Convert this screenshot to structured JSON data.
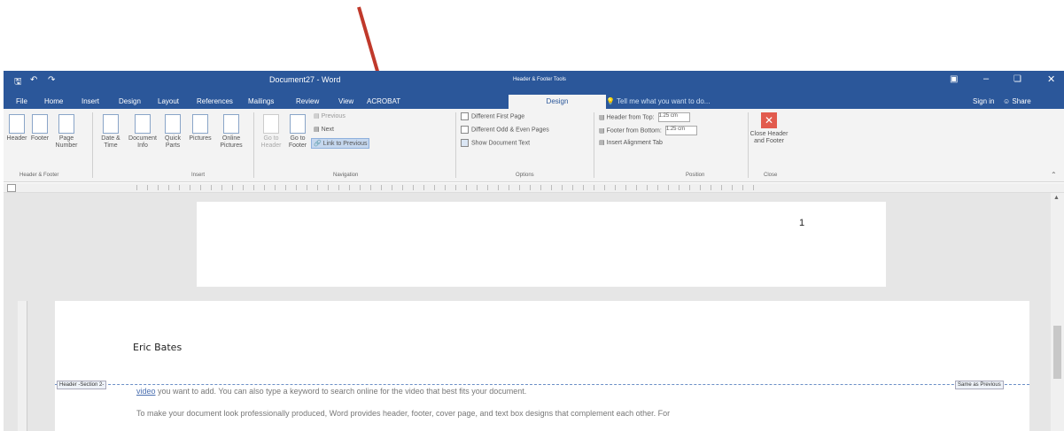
{
  "window": {
    "title": "Document27 - Word",
    "context_tab_group": "Header & Footer Tools",
    "tell_me": "Tell me what you want to do...",
    "sign_in": "Sign in",
    "share": "Share"
  },
  "tabs": [
    "File",
    "Home",
    "Insert",
    "Design",
    "Layout",
    "References",
    "Mailings",
    "Review",
    "View",
    "ACROBAT",
    "Design"
  ],
  "ribbon": {
    "header_footer": {
      "header": "Header",
      "footer": "Footer",
      "page_number": "Page Number",
      "group_label": "Header & Footer"
    },
    "insert": {
      "date_time": "Date & Time",
      "document_info": "Document Info",
      "quick_parts": "Quick Parts",
      "pictures": "Pictures",
      "online_pictures": "Online Pictures",
      "group_label": "Insert"
    },
    "navigation": {
      "go_to_header": "Go to Header",
      "go_to_footer": "Go to Footer",
      "previous": "Previous",
      "next": "Next",
      "link_to_previous": "Link to Previous",
      "group_label": "Navigation"
    },
    "options": {
      "different_first_page": "Different First Page",
      "different_odd_even": "Different Odd & Even Pages",
      "show_document_text": "Show Document Text",
      "group_label": "Options"
    },
    "position": {
      "header_from_top": "Header from Top:",
      "header_from_top_value": "1.25 cm",
      "footer_from_bottom": "Footer from Bottom:",
      "footer_from_bottom_value": "1.25 cm",
      "insert_alignment_tab": "Insert Alignment Tab",
      "group_label": "Position"
    },
    "close": {
      "close_header_footer": "Close Header and Footer",
      "group_label": "Close"
    }
  },
  "document": {
    "page_number": "1",
    "header_text": "Eric Bates",
    "header_tag": "Header -Section 2-",
    "same_as_previous": "Same as Previous",
    "body_line1_link": "video",
    "body_line1": " you want to add. You can also type a keyword to search online for the video that best fits your document.",
    "body_line2": "To make your document look professionally produced, Word provides header, footer, cover page, and text box designs that complement each other. For"
  },
  "colors": {
    "word_blue": "#2b579a",
    "arrow_red": "#c0392b",
    "close_red": "#e25b4e"
  }
}
